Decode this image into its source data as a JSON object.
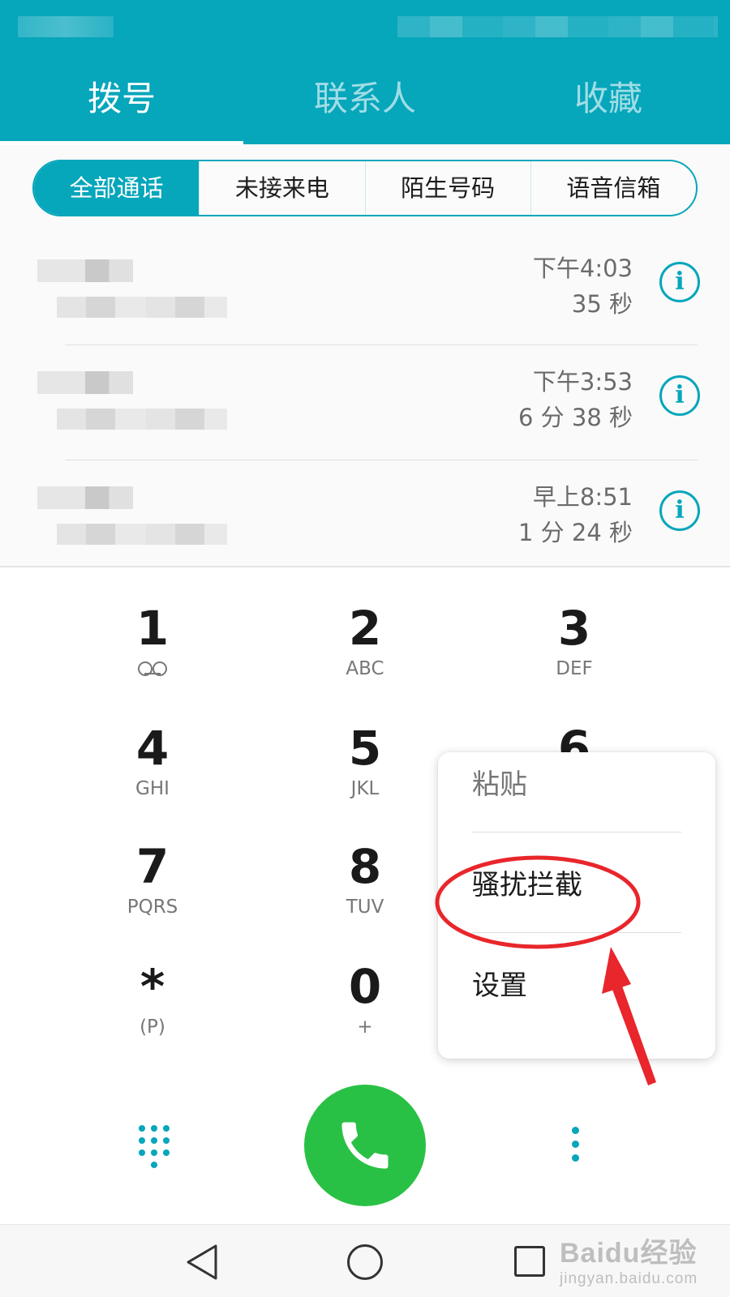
{
  "header": {
    "tabs": [
      {
        "label": "拨号",
        "active": true
      },
      {
        "label": "联系人",
        "active": false
      },
      {
        "label": "收藏",
        "active": false
      }
    ]
  },
  "filter": {
    "segments": [
      {
        "label": "全部通话",
        "active": true
      },
      {
        "label": "未接来电",
        "active": false
      },
      {
        "label": "陌生号码",
        "active": false
      },
      {
        "label": "语音信箱",
        "active": false
      }
    ]
  },
  "call_log": [
    {
      "time": "下午4:03",
      "duration": "35 秒"
    },
    {
      "time": "下午3:53",
      "duration": "6 分 38 秒"
    },
    {
      "time": "早上8:51",
      "duration": "1 分 24 秒"
    }
  ],
  "dialpad": {
    "keys": [
      {
        "digit": "1",
        "letters": ""
      },
      {
        "digit": "2",
        "letters": "ABC"
      },
      {
        "digit": "3",
        "letters": "DEF"
      },
      {
        "digit": "4",
        "letters": "GHI"
      },
      {
        "digit": "5",
        "letters": "JKL"
      },
      {
        "digit": "6",
        "letters": ""
      },
      {
        "digit": "7",
        "letters": "PQRS"
      },
      {
        "digit": "8",
        "letters": "TUV"
      },
      {
        "digit": "*",
        "letters": "(P)"
      },
      {
        "digit": "0",
        "letters": "+"
      }
    ]
  },
  "popup_menu": {
    "items": [
      {
        "label": "粘贴",
        "enabled": false
      },
      {
        "label": "骚扰拦截",
        "enabled": true,
        "highlighted": true
      },
      {
        "label": "设置",
        "enabled": true
      }
    ]
  },
  "watermark": {
    "brand": "Baidu经验",
    "url": "jingyan.baidu.com"
  },
  "colors": {
    "accent": "#06a6bb",
    "call_button": "#29c145",
    "annotation": "#e8262b"
  },
  "icons": {
    "info": "info-circle-icon",
    "voicemail": "voicemail-icon",
    "dialpad": "dialpad-grid-icon",
    "call": "phone-handset-icon",
    "more": "more-vertical-icon",
    "back": "triangle-back-icon",
    "home": "circle-home-icon",
    "recent": "square-recents-icon"
  }
}
